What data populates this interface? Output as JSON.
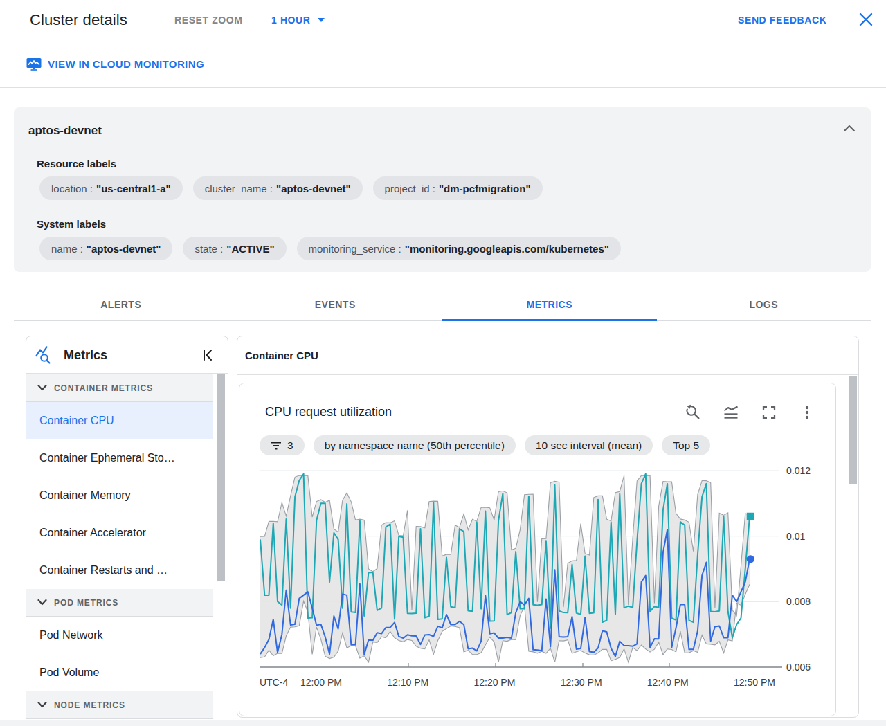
{
  "colors": {
    "accent_blue": "#1a73e8",
    "selected_item_bg": "#e8f0fe",
    "series_teal": "#1ea7b4",
    "series_blue": "#3069e0",
    "band_fill": "#e5e5e5",
    "band_outline": "#9aa0a6"
  },
  "header": {
    "title": "Cluster details",
    "reset_zoom_label": "RESET ZOOM",
    "time_range_label": "1 HOUR",
    "send_feedback_label": "SEND FEEDBACK"
  },
  "toolbar": {
    "view_in_monitoring_label": "VIEW IN CLOUD MONITORING"
  },
  "cluster_card": {
    "name": "aptos-devnet",
    "resource_labels_title": "Resource labels",
    "resource_labels": [
      {
        "key": "location :",
        "value": "\"us-central1-a\""
      },
      {
        "key": "cluster_name :",
        "value": "\"aptos-devnet\""
      },
      {
        "key": "project_id :",
        "value": "\"dm-pcfmigration\""
      }
    ],
    "system_labels_title": "System labels",
    "system_labels": [
      {
        "key": "name :",
        "value": "\"aptos-devnet\""
      },
      {
        "key": "state :",
        "value": "\"ACTIVE\""
      },
      {
        "key": "monitoring_service :",
        "value": "\"monitoring.googleapis.com/kubernetes\""
      }
    ]
  },
  "tabs": [
    {
      "label": "ALERTS"
    },
    {
      "label": "EVENTS"
    },
    {
      "label": "METRICS",
      "active": true
    },
    {
      "label": "LOGS"
    }
  ],
  "metrics_panel": {
    "title": "Metrics",
    "items": [
      {
        "label": "CONTAINER METRICS",
        "section": true
      },
      {
        "label": "Container CPU",
        "selected": true
      },
      {
        "label": "Container Ephemeral Sto…"
      },
      {
        "label": "Container Memory"
      },
      {
        "label": "Container Accelerator"
      },
      {
        "label": "Container Restarts and …"
      },
      {
        "label": "POD METRICS",
        "section": true
      },
      {
        "label": "Pod Network"
      },
      {
        "label": "Pod Volume"
      },
      {
        "label": "NODE METRICS",
        "section": true
      }
    ]
  },
  "chart_panel": {
    "title": "Container CPU",
    "card_title": "CPU request utilization",
    "chips": [
      {
        "label": "3",
        "icon": "filter-list-icon"
      },
      {
        "label": "by namespace name (50th percentile)"
      },
      {
        "label": "10 sec interval (mean)"
      },
      {
        "label": "Top 5"
      }
    ]
  },
  "chart_data": {
    "type": "line",
    "title": "CPU request utilization",
    "grid": true,
    "legend_position": "none",
    "x_axis": {
      "timezone_label": "UTC-4",
      "tick_labels": [
        "12:00 PM",
        "12:10 PM",
        "12:20 PM",
        "12:30 PM",
        "12:40 PM",
        "12:50 PM"
      ]
    },
    "y_axis": {
      "tick_labels": [
        "0.012",
        "0.01",
        "0.008",
        "0.006"
      ],
      "ylim": [
        0.006,
        0.012
      ]
    },
    "series": [
      {
        "name": "min/max band top",
        "role": "band_top",
        "values": [
          0.009991,
          0.009996,
          0.010449,
          0.010453,
          0.010441,
          0.011028,
          0.010614,
          0.011233,
          0.011803,
          0.01185,
          0.01185,
          0.01185,
          0.010581,
          0.011058,
          0.011115,
          0.011032,
          0.011093,
          0.010214,
          0.010129,
          0.011097,
          0.01132,
          0.011048,
          0.010493,
          0.010518,
          0.010492,
          0.009003,
          0.008919,
          0.00901,
          0.010335,
          0.010413,
          0.010406,
          0.010471,
          0.010022,
          0.010015,
          0.010787,
          0.00774,
          0.010298,
          0.010291,
          0.010252,
          0.011054,
          0.011069,
          0.011062,
          0.009389,
          0.009446,
          0.009442,
          0.010334,
          0.010267,
          0.010681,
          0.010194,
          0.010515,
          0.010453,
          0.010876,
          0.010881,
          0.010863,
          0.010496,
          0.011357,
          0.011381,
          0.011322,
          0.009584,
          0.009627,
          0.010198,
          0.011264,
          0.011277,
          0.01128,
          0.007991,
          0.009921,
          0.009926,
          0.011629,
          0.011675,
          0.011649,
          0.007834,
          0.009173,
          0.009247,
          0.009255,
          0.010382,
          0.009466,
          0.009421,
          0.011181,
          0.011231,
          0.011234,
          0.010517,
          0.010463,
          0.011328,
          0.011363,
          0.01185,
          0.007899,
          0.009937,
          0.011685,
          0.01185,
          0.01185,
          0.01185,
          0.007954,
          0.010911,
          0.011671,
          0.01166,
          0.01166,
          0.010692,
          0.010523,
          0.010494,
          0.010426,
          0.009534,
          0.011269,
          0.011693,
          0.011692,
          0.011634,
          0.007806,
          0.010702,
          0.010638,
          0.010714,
          0.00774,
          0.007574,
          0.00909,
          0.010692,
          0.01065
        ]
      },
      {
        "name": "min/max band bottom",
        "role": "band_bottom",
        "values": [
          0.006292,
          0.006311,
          0.006519,
          0.006347,
          0.006423,
          0.006416,
          0.006955,
          0.007224,
          0.00723,
          0.007263,
          0.008016,
          0.007686,
          0.006391,
          0.007221,
          0.006851,
          0.006333,
          0.006262,
          0.006306,
          0.006493,
          0.007041,
          0.006588,
          0.006656,
          0.006653,
          0.006276,
          0.006344,
          0.00615,
          0.006769,
          0.006755,
          0.006925,
          0.006894,
          0.007088,
          0.006898,
          0.006812,
          0.006775,
          0.006842,
          0.006815,
          0.006639,
          0.006576,
          0.006555,
          0.006833,
          0.006396,
          0.006809,
          0.007091,
          0.007177,
          0.007258,
          0.007242,
          0.007205,
          0.006462,
          0.006515,
          0.006385,
          0.006382,
          0.006442,
          0.006678,
          0.006917,
          0.00677,
          0.00615,
          0.006806,
          0.006791,
          0.006848,
          0.006835,
          0.007579,
          0.007856,
          0.006489,
          0.006467,
          0.006426,
          0.006481,
          0.00642,
          0.006579,
          0.00615,
          0.006807,
          0.0068,
          0.00683,
          0.00642,
          0.006472,
          0.006508,
          0.006431,
          0.006378,
          0.006372,
          0.006433,
          0.006541,
          0.006543,
          0.006193,
          0.006239,
          0.006296,
          0.006557,
          0.00615,
          0.006601,
          0.0065,
          0.006675,
          0.006556,
          0.006463,
          0.006548,
          0.006762,
          0.006381,
          0.006554,
          0.006538,
          0.006467,
          0.007097,
          0.006436,
          0.006441,
          0.006503,
          0.006453,
          0.00698,
          0.006708,
          0.0067,
          0.00668,
          0.006787,
          0.006433,
          0.006831,
          0.006803,
          0.007958,
          0.007893,
          0.008222,
          0.008528
        ]
      },
      {
        "name": "namespace 50th percentile (teal)",
        "role": "line",
        "color_key": "series_teal",
        "marker": "square",
        "values": [
          0.0099,
          0.0082,
          0.0082,
          0.0104,
          0.008,
          0.0079,
          0.010524,
          0.007801,
          0.0112,
          0.0117,
          0.0119,
          0.0075,
          0.007509,
          0.010485,
          0.011,
          0.011,
          0.0086,
          0.0101,
          0.0099,
          0.0078,
          0.010988,
          0.007686,
          0.007671,
          0.010467,
          0.007563,
          0.00889,
          0.008893,
          0.007734,
          0.007802,
          0.010273,
          0.010365,
          0.007468,
          0.009993,
          0.009968,
          0.007642,
          0.007637,
          0.007646,
          0.010228,
          0.007508,
          0.007559,
          0.01102,
          0.007455,
          0.007473,
          0.009351,
          0.007843,
          0.007819,
          0.010224,
          0.010138,
          0.007722,
          0.007705,
          0.010423,
          0.007783,
          0.010761,
          0.007403,
          0.007411,
          0.010468,
          0.0113,
          0.0076,
          0.00767,
          0.009527,
          0.007788,
          0.007786,
          0.01122,
          0.007907,
          0.007894,
          0.007909,
          0.00986,
          0.007188,
          0.011562,
          0.007718,
          0.007667,
          0.007663,
          0.009138,
          0.007649,
          0.007612,
          0.009388,
          0.007643,
          0.007658,
          0.011118,
          0.007373,
          0.007428,
          0.010426,
          0.007615,
          0.011287,
          0.00781,
          0.007866,
          0.007822,
          0.009844,
          0.0116,
          0.0119,
          0.0077,
          0.007851,
          0.007821,
          0.0108,
          0.0116,
          0.0075,
          0.007438,
          0.010435,
          0.010335,
          0.007429,
          0.00737,
          0.009426,
          0.0112,
          0.0116,
          0.0077,
          0.007693,
          0.007715,
          0.0106,
          0.0077,
          0.0069,
          0.0073,
          0.0075,
          0.009,
          0.0106
        ]
      },
      {
        "name": "namespace 50th percentile (blue)",
        "role": "line",
        "color_key": "series_blue",
        "marker": "circle",
        "values": [
          0.0064,
          0.0066,
          0.006846,
          0.007458,
          0.006448,
          0.007,
          0.008352,
          0.007286,
          0.007308,
          0.0081,
          0.0082,
          0.0083,
          0.0078,
          0.007279,
          0.007307,
          0.006926,
          0.0064,
          0.007561,
          0.007169,
          0.008232,
          0.0082,
          0.006684,
          0.006685,
          0.008541,
          0.006388,
          0.006828,
          0.00682,
          0.007049,
          0.007023,
          0.00721,
          0.007214,
          0.007367,
          0.006937,
          0.006883,
          0.006987,
          0.006956,
          0.006951,
          0.006692,
          0.006985,
          0.006993,
          0.006937,
          0.007249,
          0.007203,
          0.007605,
          0.0073,
          0.0073,
          0.0074,
          0.0073,
          0.006563,
          0.006579,
          0.006496,
          0.006794,
          0.008183,
          0.007021,
          0.007043,
          0.006888,
          0.00689,
          0.006909,
          0.006886,
          0.007659,
          0.008,
          0.0079,
          0.0081,
          0.006533,
          0.006522,
          0.006501,
          0.008082,
          0.006624,
          0.008972,
          0.006931,
          0.006918,
          0.006929,
          0.007543,
          0.006551,
          0.006568,
          0.007521,
          0.006474,
          0.006455,
          0.006584,
          0.007109,
          0.007077,
          0.006575,
          0.006328,
          0.006791,
          0.006657,
          0.006657,
          0.006637,
          0.006713,
          0.0086,
          0.0088,
          0.0066,
          0.006864,
          0.006862,
          0.0095,
          0.0102,
          0.0066,
          0.007198,
          0.007912,
          0.007913,
          0.006542,
          0.006542,
          0.007108,
          0.0088,
          0.0092,
          0.0068,
          0.007234,
          0.007256,
          0.0069,
          0.0069,
          0.0082,
          0.008,
          0.0083,
          0.0086,
          0.0093
        ]
      }
    ]
  }
}
